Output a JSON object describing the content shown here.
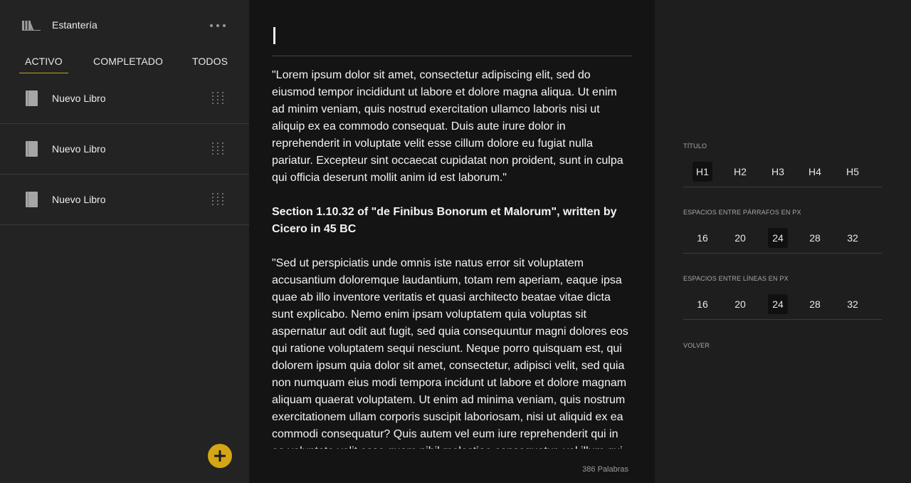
{
  "sidebar": {
    "title": "Estantería",
    "tabs": [
      {
        "label": "ACTIVO"
      },
      {
        "label": "COMPLETADO"
      },
      {
        "label": "TODOS"
      }
    ],
    "books": [
      {
        "title": "Nuevo Libro"
      },
      {
        "title": "Nuevo Libro"
      },
      {
        "title": "Nuevo Libro"
      }
    ],
    "icons": {
      "logo": "bookshelf-icon",
      "more": "more-horizontal-icon",
      "book": "book-icon",
      "drag": "drag-handle-icon",
      "add": "plus-icon"
    }
  },
  "editor": {
    "title": "",
    "paragraph1": "\"Lorem ipsum dolor sit amet, consectetur adipiscing elit, sed do eiusmod tempor incididunt ut labore et dolore magna aliqua. Ut enim ad minim veniam, quis nostrud exercitation ullamco laboris nisi ut aliquip ex ea commodo consequat. Duis aute irure dolor in reprehenderit in voluptate velit esse cillum dolore eu fugiat nulla pariatur. Excepteur sint occaecat cupidatat non proident, sunt in culpa qui officia deserunt mollit anim id est laborum.\"",
    "heading": "Section 1.10.32 of \"de Finibus Bonorum et Malorum\", written by Cicero in 45 BC",
    "paragraph2": "\"Sed ut perspiciatis unde omnis iste natus error sit voluptatem accusantium doloremque laudantium, totam rem aperiam, eaque ipsa quae ab illo inventore veritatis et quasi architecto beatae vitae dicta sunt explicabo. Nemo enim ipsam voluptatem quia voluptas sit aspernatur aut odit aut fugit, sed quia consequuntur magni dolores eos qui ratione voluptatem sequi nesciunt. Neque porro quisquam est, qui dolorem ipsum quia dolor sit amet, consectetur, adipisci velit, sed quia non numquam eius modi tempora incidunt ut labore et dolore magnam aliquam quaerat voluptatem. Ut enim ad minima veniam, quis nostrum exercitationem ullam corporis suscipit laboriosam, nisi ut aliquid ex ea commodi consequatur? Quis autem vel eum iure reprehenderit qui in ea voluptate velit esse quam nihil molestiae consequatur, vel illum qui dolorem eum fugiat quo voluptas nulla pariatur?\"",
    "word_count": "386 Palabras"
  },
  "settings": {
    "title_label": "TÍTULO",
    "title_options": [
      "H1",
      "H2",
      "H3",
      "H4",
      "H5"
    ],
    "title_selected": "H1",
    "paragraph_label": "ESPACIOS ENTRE PÁRRAFOS EN PX",
    "paragraph_options": [
      "16",
      "20",
      "24",
      "28",
      "32"
    ],
    "paragraph_selected": "24",
    "line_label": "ESPACIOS ENTRE LÍNEAS EN PX",
    "line_options": [
      "16",
      "20",
      "24",
      "28",
      "32"
    ],
    "line_selected": "24",
    "back_label": "VOLVER"
  },
  "colors": {
    "accent": "#d4a514",
    "sidebar_bg": "#232323",
    "editor_bg": "#141414",
    "settings_bg": "#1e1e1e"
  }
}
